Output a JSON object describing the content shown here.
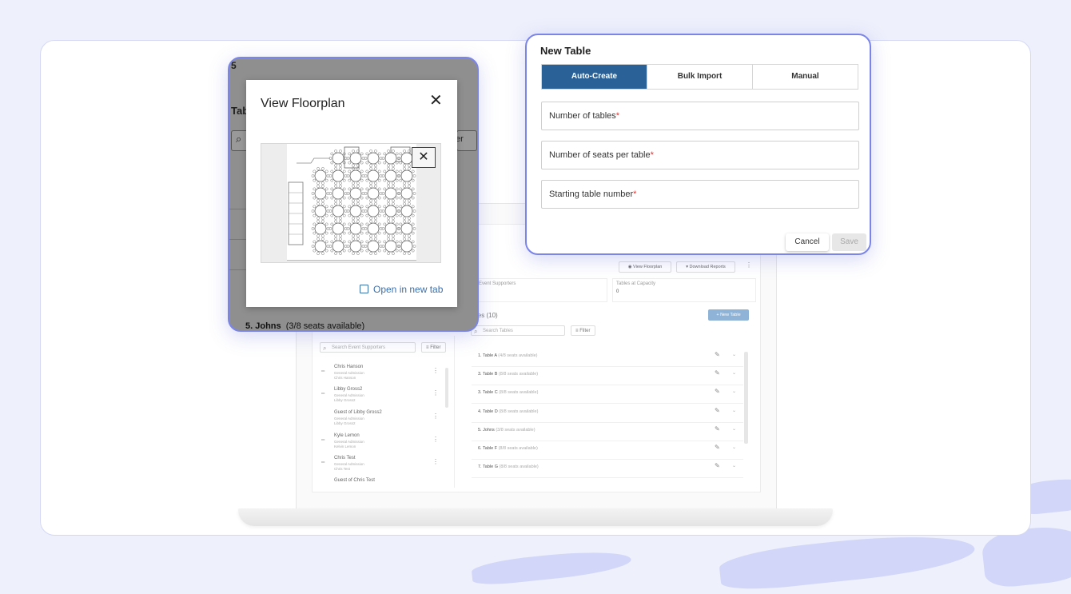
{
  "floorplan_modal": {
    "title": "View Floorplan",
    "open_new_tab": "Open in new tab",
    "bg_top_char": "5",
    "bg_heading_fragment": "Tab",
    "bg_filter_fragment": "er",
    "bg_row_label": "5. Johns",
    "bg_row_seats": "(3/8 seats available)"
  },
  "new_table_modal": {
    "title": "New Table",
    "tabs": [
      {
        "label": "Auto-Create",
        "active": true
      },
      {
        "label": "Bulk Import",
        "active": false
      },
      {
        "label": "Manual",
        "active": false
      }
    ],
    "fields": [
      {
        "label": "Number of tables",
        "required": "*"
      },
      {
        "label": "Number of seats per table",
        "required": "*"
      },
      {
        "label": "Starting table number",
        "required": "*"
      }
    ],
    "cancel_label": "Cancel",
    "save_label": "Save"
  },
  "background_app": {
    "view_floorplan_label": "View Floorplan",
    "download_reports_label": "Download Reports",
    "stat_1_label": "Event Supporters",
    "stat_2_label": "Tables at Capacity",
    "stat_2_value": "0",
    "tables_heading": "les (10)",
    "new_table_label": "+ New Table",
    "search_tables_placeholder": "Search Tables",
    "search_supporters_placeholder": "Search Event Supporters",
    "filter_label": "Filter",
    "supporters": [
      {
        "name": "Chris Hanson",
        "line1": "General Admission",
        "line2": "Chris Hanson"
      },
      {
        "name": "Libby Gross2",
        "line1": "General Admission",
        "line2": "Libby Gross2"
      },
      {
        "name": "Guest of Libby Gross2",
        "line1": "General Admission",
        "line2": "Libby Gross2"
      },
      {
        "name": "Kyle Lemon",
        "line1": "General Admission",
        "line2": "Kelvin Lemon"
      },
      {
        "name": "Chris Test",
        "line1": "General Admission",
        "line2": "Chris Test"
      },
      {
        "name": "Guest of Chris Test",
        "line1": "",
        "line2": ""
      }
    ],
    "tables": [
      {
        "name": "1. Table A",
        "seats": "(4/8 seats available)"
      },
      {
        "name": "3. Table B",
        "seats": "(8/8 seats available)"
      },
      {
        "name": "3. Table C",
        "seats": "(8/8 seats available)"
      },
      {
        "name": "4. Table D",
        "seats": "(8/8 seats available)"
      },
      {
        "name": "5. Johns",
        "seats": "(3/8 seats available)"
      },
      {
        "name": "6. Table F",
        "seats": "(8/8 seats available)"
      },
      {
        "name": "7. Table G",
        "seats": "(8/8 seats available)"
      }
    ]
  },
  "colors": {
    "accent_blue": "#2a6298",
    "frame_purple": "#7b85e8",
    "background": "#eef0fc"
  }
}
